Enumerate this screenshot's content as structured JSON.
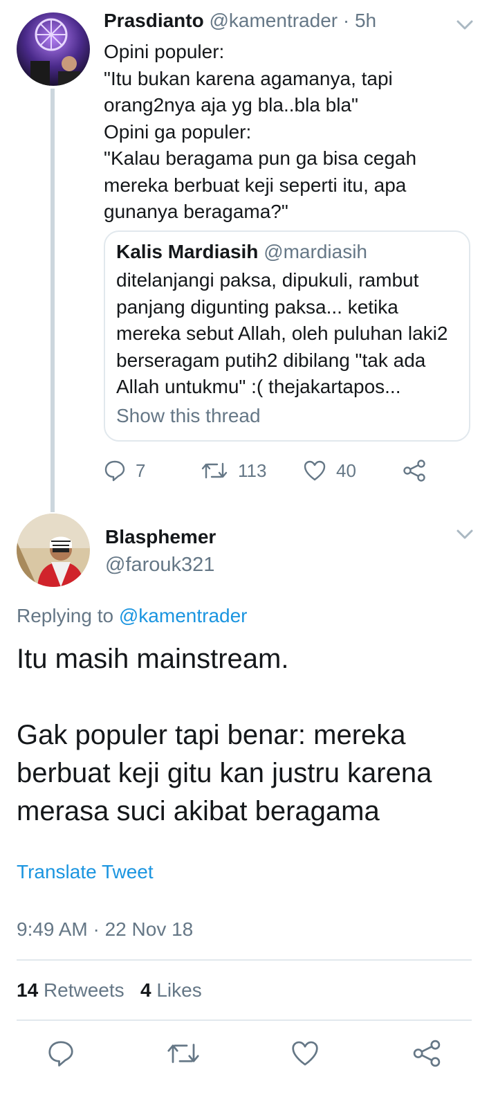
{
  "tweet1": {
    "name": "Prasdianto",
    "handle": "@kamentrader",
    "time": "· 5h",
    "text": "Opini populer:\n\"Itu bukan karena agamanya, tapi orang2nya aja yg bla..bla bla\"\nOpini ga populer:\n\"Kalau beragama pun ga bisa cegah mereka berbuat keji seperti itu, apa gunanya beragama?\"",
    "quote": {
      "name": "Kalis Mardiasih",
      "handle": "@mardiasih",
      "text": "ditelanjangi paksa, dipukuli, rambut panjang digunting paksa... ketika mereka sebut Allah, oleh puluhan laki2 berseragam putih2 dibilang \"tak ada Allah untukmu\" :( thejakartapos...",
      "show_thread": "Show this thread"
    },
    "replies": "7",
    "retweets": "113",
    "likes": "40"
  },
  "tweet2": {
    "name": "Blasphemer",
    "handle": "@farouk321",
    "replying_prefix": "Replying to",
    "replying_to": "@kamentrader",
    "text": "Itu masih mainstream.\n\nGak populer tapi benar: mereka berbuat keji gitu kan justru karena merasa suci akibat beragama",
    "translate": "Translate Tweet",
    "timestamp": "9:49 AM · 22 Nov 18",
    "retweet_count": "14",
    "retweet_label": "Retweets",
    "like_count": "4",
    "like_label": "Likes"
  },
  "icons": {
    "reply": "reply-icon",
    "retweet": "retweet-icon",
    "like": "heart-icon",
    "share": "share-icon",
    "more": "chevron-down-icon"
  },
  "colors": {
    "link": "#1b95e0",
    "secondary_text": "#657786",
    "border": "#e1e8ed",
    "thread_line": "#ccd6dd"
  }
}
